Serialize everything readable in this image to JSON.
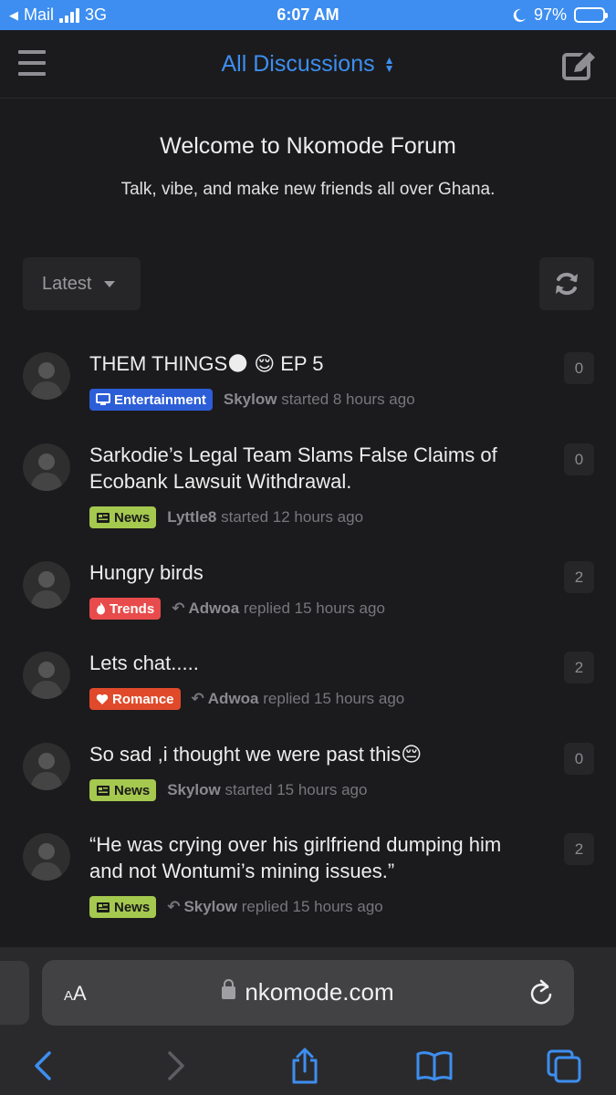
{
  "status_bar": {
    "back_app": "Mail",
    "network": "3G",
    "time": "6:07 AM",
    "battery": "97%",
    "battery_level": 0.97
  },
  "header": {
    "title": "All Discussions",
    "caret": "▲\n▼"
  },
  "hero": {
    "title": "Welcome to Nkomode Forum",
    "subtitle": "Talk, vibe, and make new friends all over Ghana."
  },
  "toolbar": {
    "sort_label": "Latest"
  },
  "discussions": [
    {
      "title": "THEM THINGS🌑 😌 EP 5",
      "tag": "Entertainment",
      "tag_icon": "tv-icon",
      "user": "Skylow",
      "action": "started 8 hours ago",
      "replies": "0",
      "replied": false
    },
    {
      "title": "Sarkodie’s Legal Team Slams False Claims of Ecobank Lawsuit Withdrawal.",
      "tag": "News",
      "tag_icon": "newspaper-icon",
      "user": "Lyttle8",
      "action": "started 12 hours ago",
      "replies": "0",
      "replied": false
    },
    {
      "title": "Hungry birds",
      "tag": "Trends",
      "tag_icon": "fire-icon",
      "user": "Adwoa",
      "action": "replied 15 hours ago",
      "replies": "2",
      "replied": true
    },
    {
      "title": "Lets chat.....",
      "tag": "Romance",
      "tag_icon": "heart-icon",
      "user": "Adwoa",
      "action": "replied 15 hours ago",
      "replies": "2",
      "replied": true
    },
    {
      "title": "So sad ,i thought we were past this😔",
      "tag": "News",
      "tag_icon": "newspaper-icon",
      "user": "Skylow",
      "action": "started 15 hours ago",
      "replies": "0",
      "replied": false
    },
    {
      "title": "“He was crying over his girlfriend dumping him and not Wontumi’s mining issues.”",
      "tag": "News",
      "tag_icon": "newspaper-icon",
      "user": "Skylow",
      "action": "replied 15 hours ago",
      "replies": "2",
      "replied": true
    }
  ],
  "browser": {
    "text_size_label_small": "A",
    "text_size_label_large": "A",
    "url": "nkomode.com"
  },
  "colors": {
    "accent": "#3d8ef0",
    "background": "#1b1b1d",
    "entertainment": "#2c5ed8",
    "news": "#a5c84f",
    "trends": "#e84b4b",
    "romance": "#e04a2a"
  }
}
